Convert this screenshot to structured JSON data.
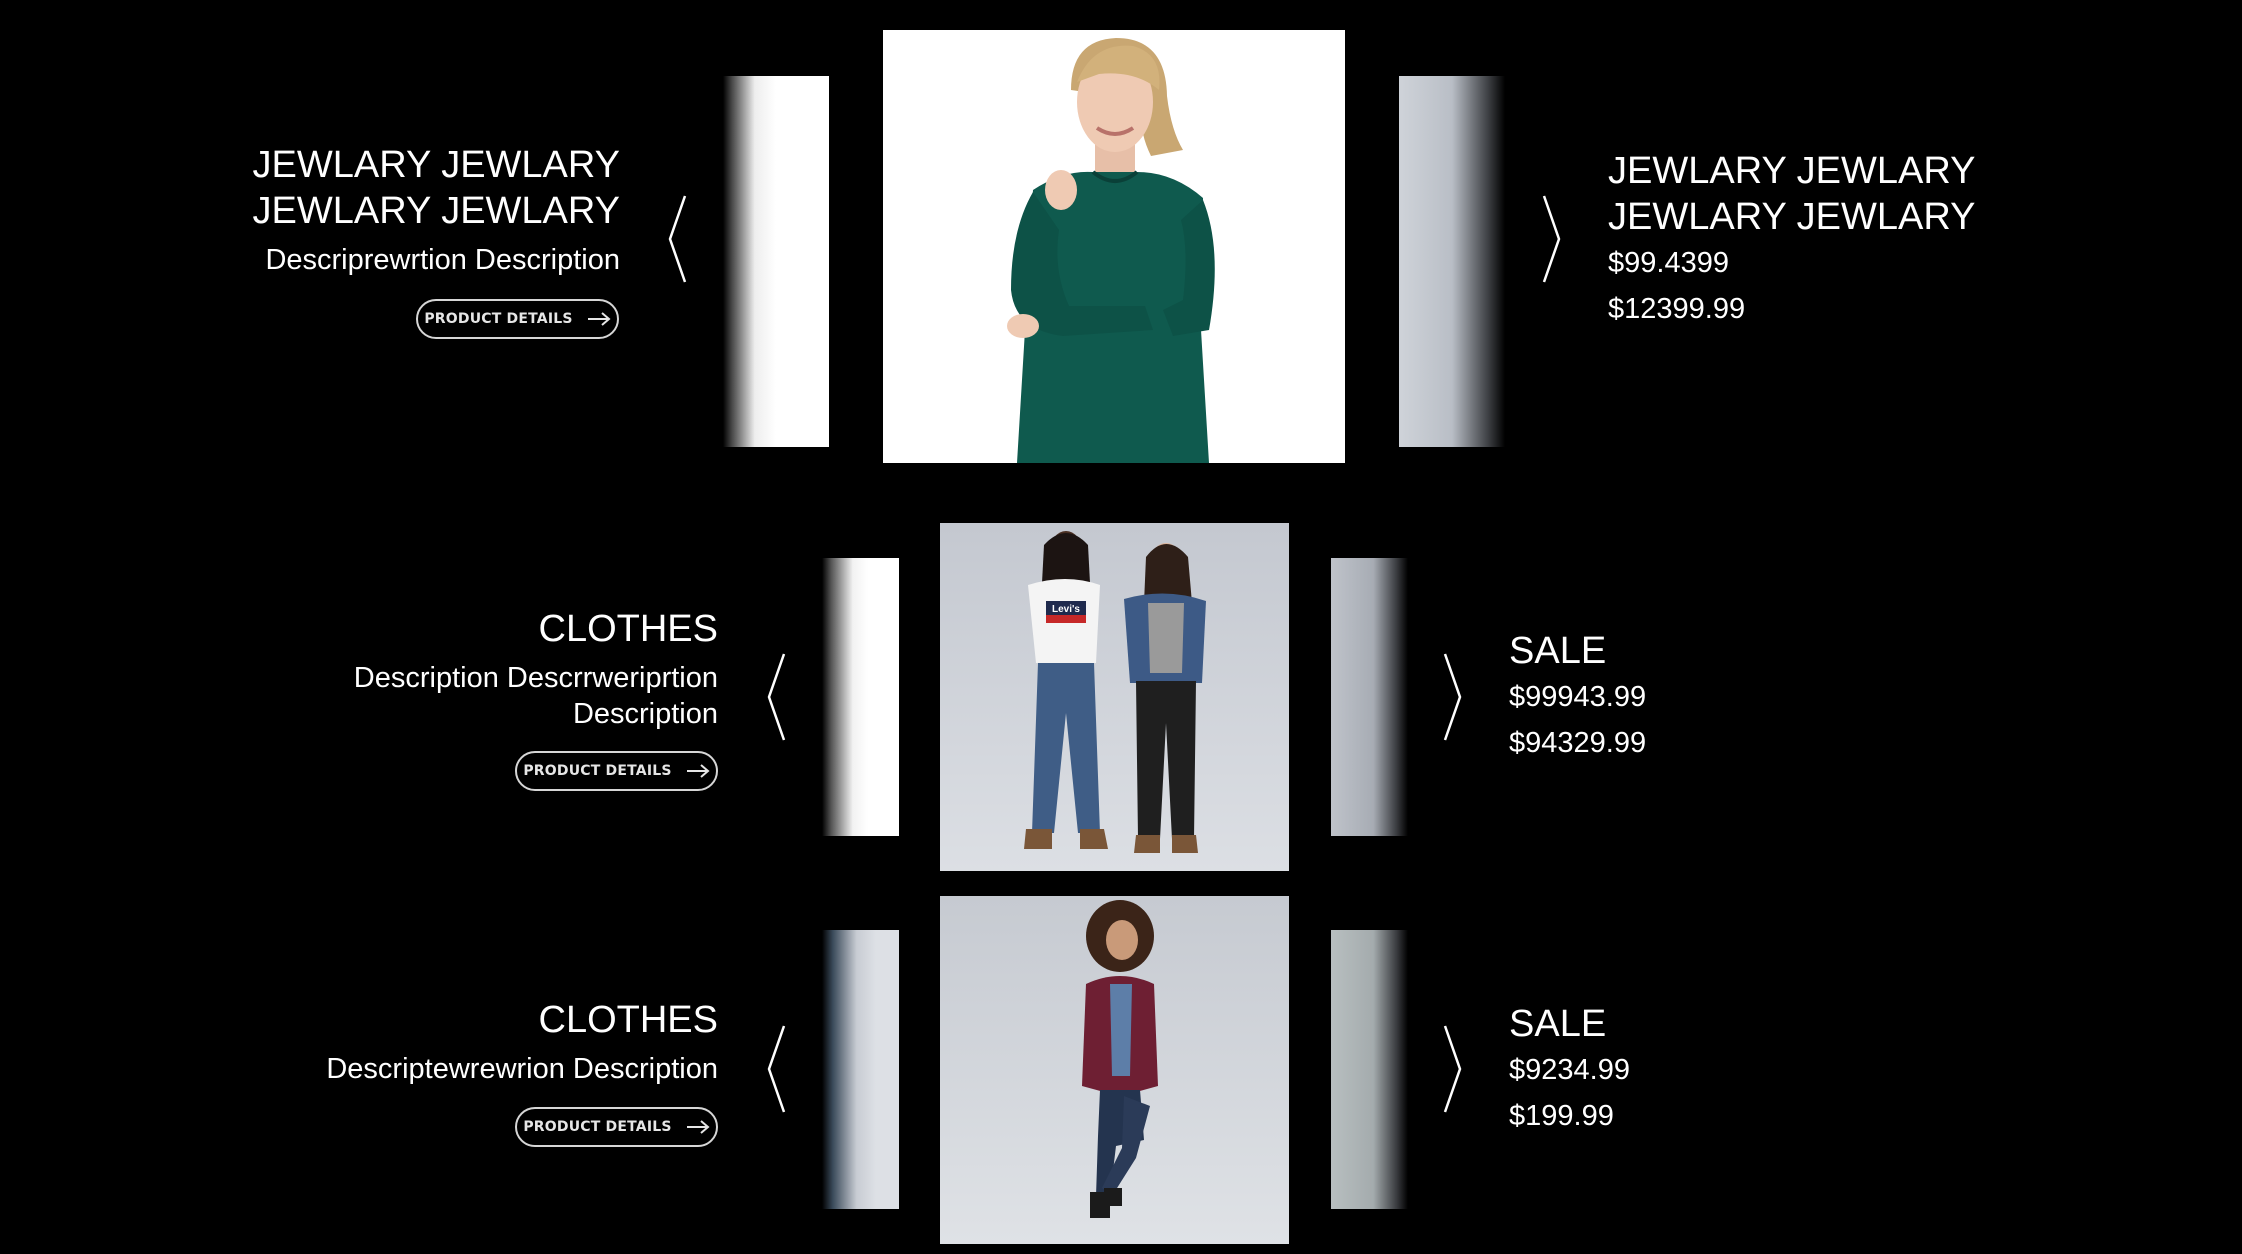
{
  "rows": [
    {
      "title_lines": [
        "JEWLARY JEWLARY",
        "JEWLARY JEWLARY"
      ],
      "description_lines": [
        "Descriprewrtion  Description"
      ],
      "button_label": "PRODUCT DETAILS",
      "right_title_lines": [
        "JEWLARY JEWLARY",
        "JEWLARY JEWLARY"
      ],
      "prices": [
        "$99.4399",
        "$12399.99"
      ]
    },
    {
      "title_lines": [
        "CLOTHES"
      ],
      "description_lines": [
        "Description Descrrweriprtion",
        "Description"
      ],
      "button_label": "PRODUCT DETAILS",
      "right_title_lines": [
        "SALE"
      ],
      "prices": [
        "$99943.99",
        "$94329.99"
      ]
    },
    {
      "title_lines": [
        "CLOTHES"
      ],
      "description_lines": [
        "Descriptewrewrion  Description"
      ],
      "button_label": "PRODUCT DETAILS",
      "right_title_lines": [
        "SALE"
      ],
      "prices": [
        "$9234.99",
        "$199.99"
      ]
    }
  ],
  "photo_shirt_text": "Levi's",
  "icons": {
    "prev": "chevron-left-icon",
    "next": "chevron-right-icon",
    "button_arrow": "arrow-right-icon"
  },
  "colors": {
    "background": "#000000",
    "text": "#ffffff",
    "button_border": "#d6d6d6",
    "sweater_green": "#0f5a4e",
    "cardigan_maroon": "#6e1f33",
    "studio_gray": "#c9ccd2"
  }
}
